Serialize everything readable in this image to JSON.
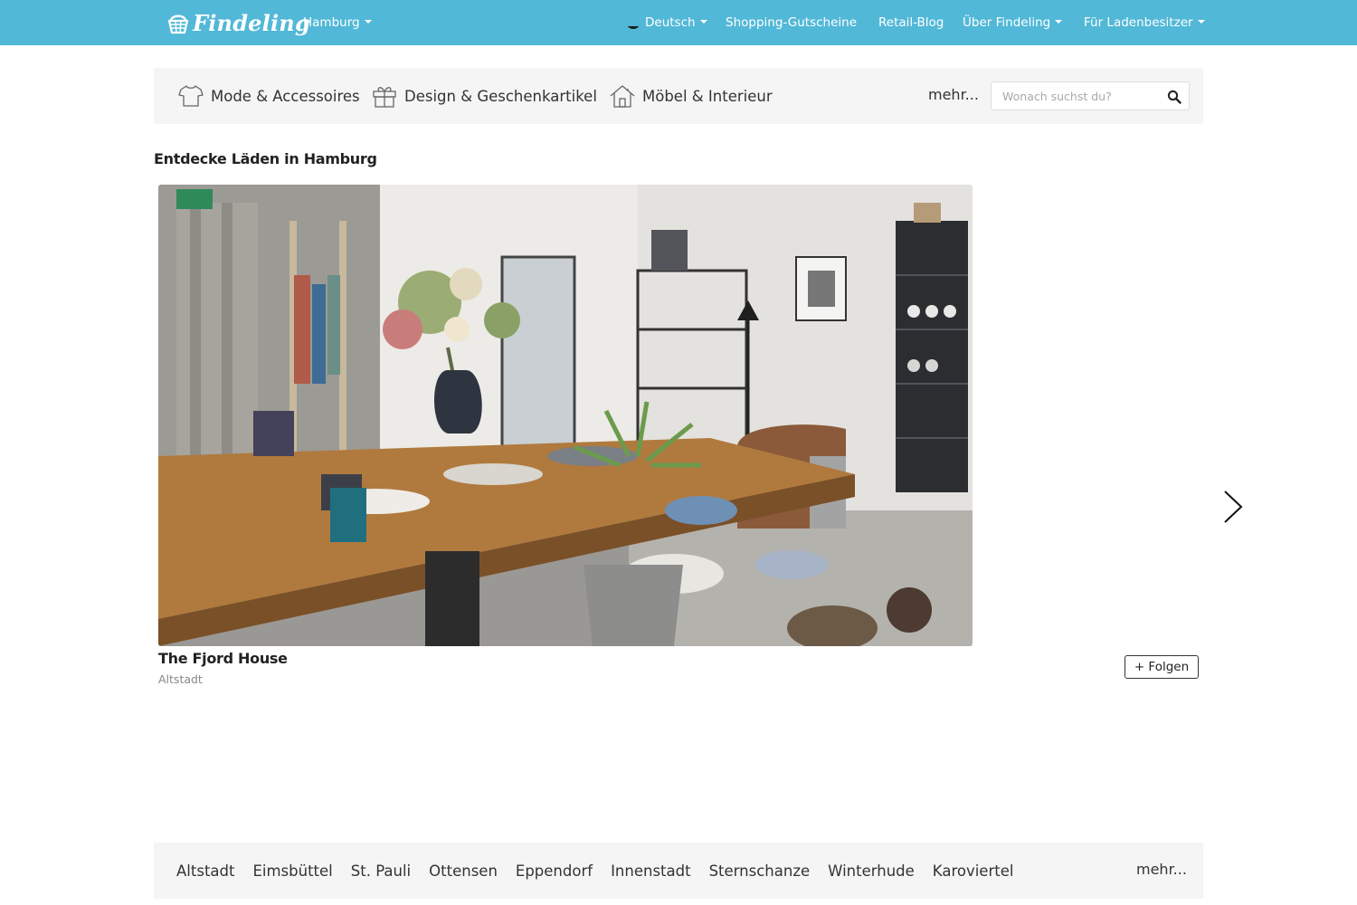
{
  "navbar": {
    "logo_text": "Findeling",
    "city": "Hamburg",
    "language": "Deutsch",
    "links": [
      "Shopping-Gutscheine",
      "Retail-Blog",
      "Über Findeling",
      "Für Ladenbesitzer"
    ]
  },
  "categories": {
    "items": [
      {
        "label": "Mode & Accessoires",
        "icon": "tshirt-icon"
      },
      {
        "label": "Design & Geschenkartikel",
        "icon": "gift-icon"
      },
      {
        "label": "Möbel & Interieur",
        "icon": "house-icon"
      }
    ],
    "more_label": "mehr...",
    "search_placeholder": "Wonach suchst du?"
  },
  "main": {
    "title": "Entdecke Läden in Hamburg",
    "shop": {
      "name": "The Fjord House",
      "district": "Altstadt",
      "follow_label": "+ Folgen"
    }
  },
  "districts": {
    "items": [
      "Altstadt",
      "Eimsbüttel",
      "St. Pauli",
      "Ottensen",
      "Eppendorf",
      "Innenstadt",
      "Sternschanze",
      "Winterhude",
      "Karoviertel"
    ],
    "more_label": "mehr..."
  },
  "colors": {
    "navbar": "#52b8d7",
    "bar_background": "#f5f5f5"
  }
}
